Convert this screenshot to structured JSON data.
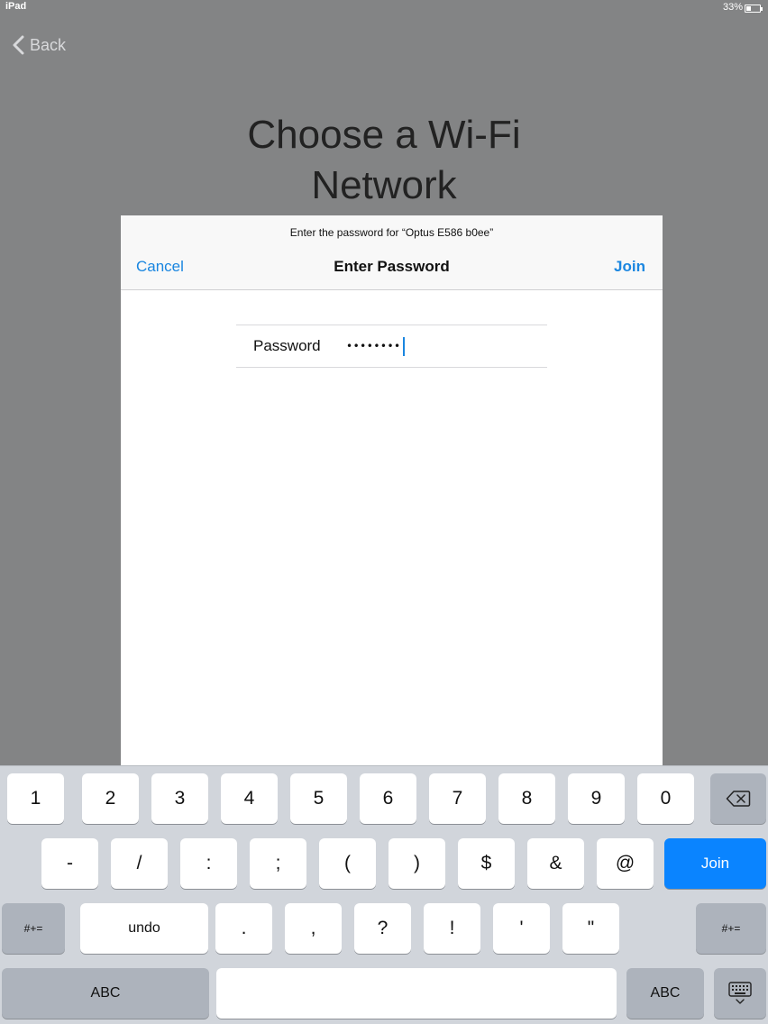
{
  "status_bar": {
    "carrier": "iPad",
    "battery": "33%",
    "battery_level": 0.33
  },
  "nav": {
    "back_label": "Back"
  },
  "page": {
    "title_lines": [
      "Choose a Wi-Fi",
      "Network"
    ]
  },
  "dialog": {
    "prompt": "Enter the password for “Optus E586 b0ee”",
    "title": "Enter Password",
    "cancel_label": "Cancel",
    "join_label": "Join",
    "password_label": "Password",
    "password_masked": "••••••••"
  },
  "keyboard": {
    "row1": [
      "1",
      "2",
      "3",
      "4",
      "5",
      "6",
      "7",
      "8",
      "9",
      "0"
    ],
    "row2": [
      "-",
      "/",
      ":",
      ";",
      "(",
      ")",
      "$",
      "&",
      "@"
    ],
    "row2_return": "Join",
    "row3_shift_left": "#+=",
    "row3_undo": "undo",
    "row3": [
      ".",
      ",",
      "?",
      "!",
      "'",
      "\""
    ],
    "row3_shift_right": "#+=",
    "row4_abc_left": "ABC",
    "row4_abc_right": "ABC"
  },
  "icons": {
    "back": "chevron-left-icon",
    "delete": "delete-icon",
    "dismiss": "keyboard-dismiss-icon"
  },
  "colors": {
    "accent": "#1a86e0",
    "join_key": "#0a84ff",
    "backdrop": "#838485"
  }
}
